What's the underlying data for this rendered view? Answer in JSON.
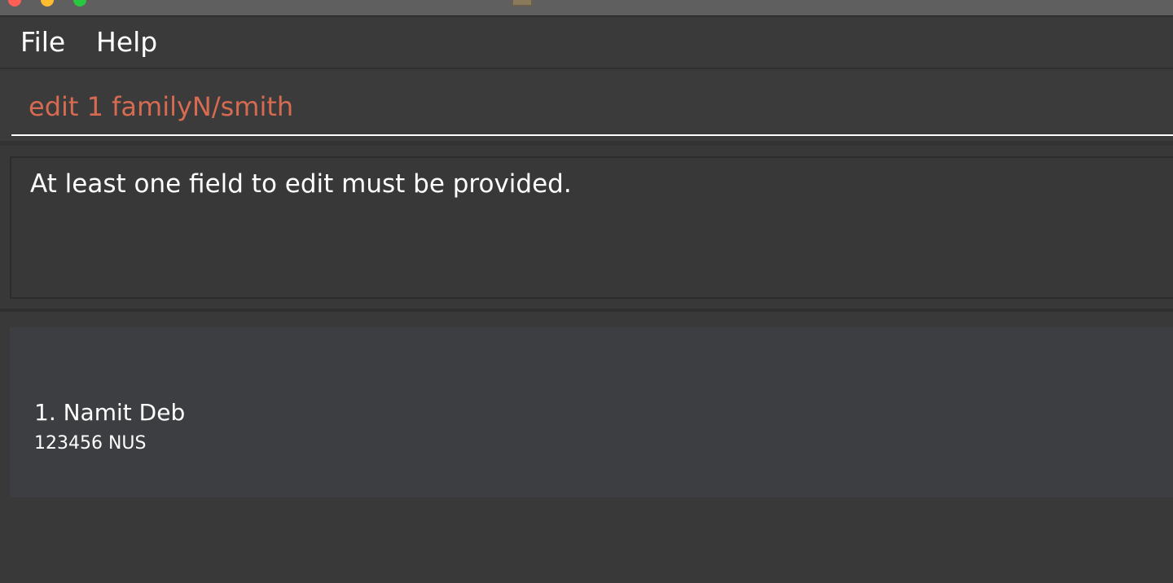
{
  "menu": {
    "file_label": "File",
    "help_label": "Help"
  },
  "command_box": {
    "value": "edit 1 familyN/smith",
    "text_color": "#d76b52"
  },
  "result_display": {
    "message": "At least one field to edit must be provided."
  },
  "person_list": {
    "items": [
      {
        "name": "1. Namit Deb",
        "details": "123456 NUS"
      }
    ]
  },
  "window": {
    "controls": [
      "close-icon",
      "minimize-icon",
      "zoom-icon"
    ]
  }
}
